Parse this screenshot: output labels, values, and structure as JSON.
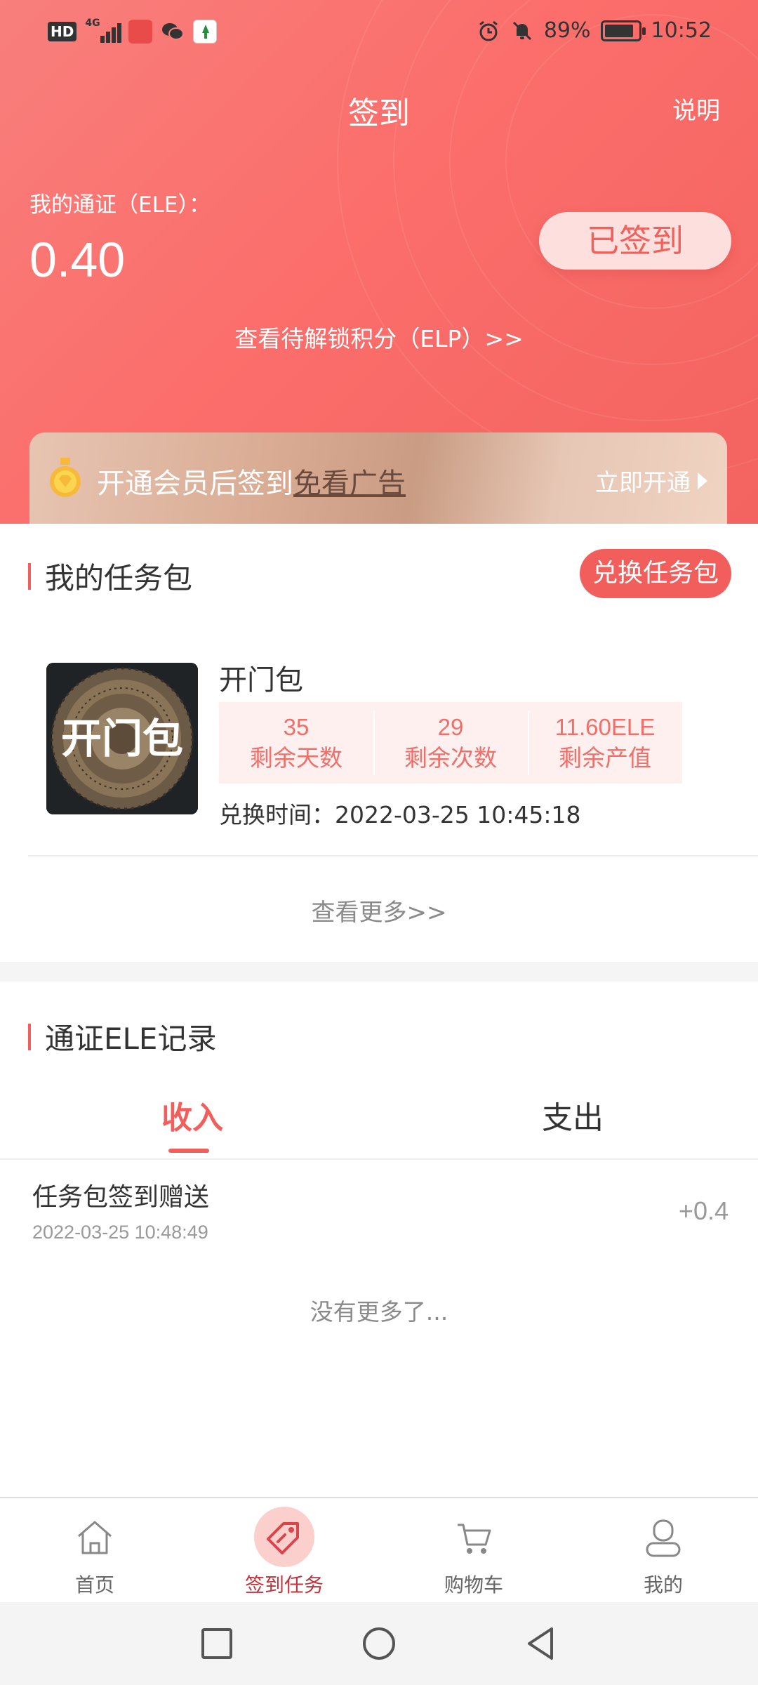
{
  "status_bar": {
    "hd": "HD",
    "network": "4G",
    "battery_text": "89%",
    "battery_level": 0.89,
    "time": "10:52"
  },
  "header": {
    "title": "签到",
    "help": "说明",
    "token_label": "我的通证（ELE）：",
    "token_value": "0.40",
    "signed_button": "已签到",
    "elp_link": "查看待解锁积分（ELP）>>"
  },
  "vip_banner": {
    "text_prefix": "开通会员后签到",
    "text_underlined": "免看广告",
    "action": "立即开通"
  },
  "task_section": {
    "title": "我的任务包",
    "exchange_button": "兑换任务包",
    "package": {
      "image_text": "开门包",
      "name": "开门包",
      "stats": [
        {
          "value": "35",
          "label": "剩余天数"
        },
        {
          "value": "29",
          "label": "剩余次数"
        },
        {
          "value": "11.60ELE",
          "label": "剩余产值"
        }
      ],
      "exchange_time": "兑换时间：2022-03-25 10:45:18"
    },
    "more": "查看更多>>"
  },
  "records_section": {
    "title": "通证ELE记录",
    "tabs": [
      {
        "label": "收入",
        "active": true
      },
      {
        "label": "支出",
        "active": false
      }
    ],
    "items": [
      {
        "title": "任务包签到赠送",
        "time": "2022-03-25 10:48:49",
        "amount": "+0.4"
      }
    ],
    "no_more": "没有更多了..."
  },
  "bottom_nav": {
    "items": [
      {
        "label": "首页",
        "icon": "home-icon",
        "active": false
      },
      {
        "label": "签到任务",
        "icon": "tag-icon",
        "active": true
      },
      {
        "label": "购物车",
        "icon": "cart-icon",
        "active": false
      },
      {
        "label": "我的",
        "icon": "user-icon",
        "active": false
      }
    ]
  },
  "colors": {
    "accent": "#f15e5b",
    "header_gradient": [
      "#f87f7c",
      "#f3635f"
    ],
    "active_nav": "#c2323a"
  }
}
